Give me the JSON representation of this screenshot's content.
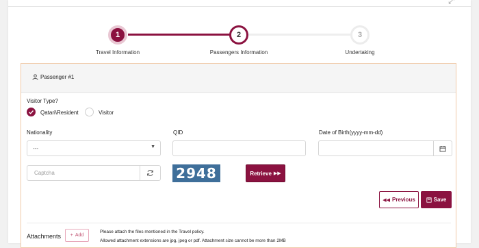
{
  "stepper": {
    "steps": [
      {
        "number": "1",
        "label": "Travel Information",
        "state": "completed"
      },
      {
        "number": "2",
        "label": "Passengers Information",
        "state": "active"
      },
      {
        "number": "3",
        "label": "Undertaking",
        "state": "pending"
      }
    ]
  },
  "panel": {
    "title": "Passenger #1",
    "visitor_type_label": "Visitor Type?",
    "visitor_type_options": [
      "Qatari\\Resident",
      "Visitor"
    ],
    "visitor_type_selected": "Qatari\\Resident",
    "nationality_label": "Nationality",
    "nationality_value": "---",
    "qid_label": "QID",
    "qid_value": "",
    "dob_label": "Date of Birth(yyyy-mm-dd)",
    "dob_value": "",
    "captcha_placeholder": "Captcha",
    "captcha_code": "2948",
    "retrieve_label": "Retrieve",
    "previous_label": "Previous",
    "save_label": "Save",
    "attachments_label": "Attachments",
    "add_label": "Add",
    "attach_note_1": "Please attach the files mentioned in the Travel policy.",
    "attach_note_2": "Allowed attachment extensions are jpg, jpeg or pdf. Attachment size cannot be more than 2MB"
  },
  "colors": {
    "primary": "#8b1240",
    "panel_border": "#f0c9a6",
    "captcha_bg": "#3f6f9a"
  }
}
